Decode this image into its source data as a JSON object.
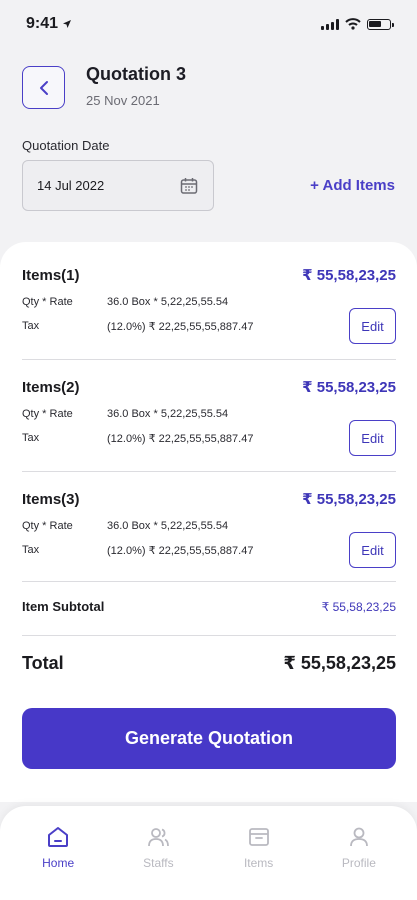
{
  "status_bar": {
    "time": "9:41"
  },
  "header": {
    "title": "Quotation 3",
    "date": "25 Nov 2021"
  },
  "quotation_date": {
    "label": "Quotation Date",
    "value": "14 Jul 2022"
  },
  "add_items_label": "+ Add Items",
  "items": [
    {
      "title": "Items(1)",
      "amount": "₹ 55,58,23,25",
      "qty_label": "Qty * Rate",
      "qty_value": "36.0 Box * 5,22,25,55.54",
      "tax_label": "Tax",
      "tax_value": "(12.0%) ₹ 22,25,55,55,887.47",
      "edit_label": "Edit"
    },
    {
      "title": "Items(2)",
      "amount": "₹ 55,58,23,25",
      "qty_label": "Qty * Rate",
      "qty_value": "36.0 Box * 5,22,25,55.54",
      "tax_label": "Tax",
      "tax_value": "(12.0%) ₹ 22,25,55,55,887.47",
      "edit_label": "Edit"
    },
    {
      "title": "Items(3)",
      "amount": "₹ 55,58,23,25",
      "qty_label": "Qty * Rate",
      "qty_value": "36.0 Box * 5,22,25,55.54",
      "tax_label": "Tax",
      "tax_value": "(12.0%) ₹ 22,25,55,55,887.47",
      "edit_label": "Edit"
    }
  ],
  "subtotal": {
    "label": "Item Subtotal",
    "value": "₹ 55,58,23,25"
  },
  "total": {
    "label": "Total",
    "value": "₹ 55,58,23,25"
  },
  "generate_button_label": "Generate Quotation",
  "tabs": [
    {
      "label": "Home",
      "icon": "home-icon",
      "active": true
    },
    {
      "label": "Staffs",
      "icon": "users-icon",
      "active": false
    },
    {
      "label": "Items",
      "icon": "box-icon",
      "active": false
    },
    {
      "label": "Profile",
      "icon": "person-icon",
      "active": false
    }
  ],
  "colors": {
    "accent": "#4738c8",
    "inactive": "#b9b9c0",
    "background": "#f2f2f4"
  }
}
